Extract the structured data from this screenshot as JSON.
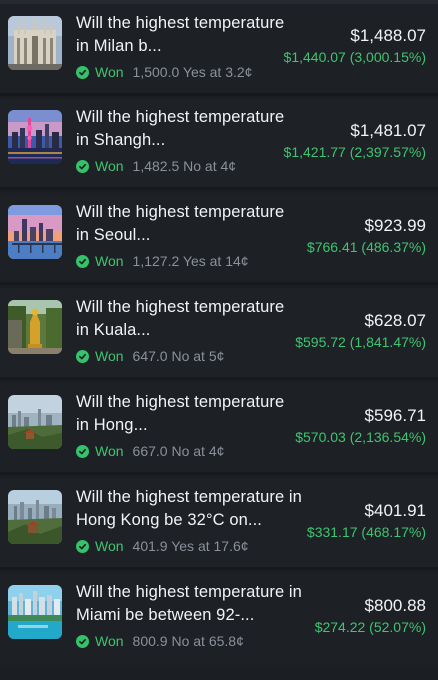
{
  "positions": [
    {
      "title": "Will the highest temperature in Milan b...",
      "status": "Won",
      "detail": "1,500.0 Yes at 3.2¢",
      "value": "$1,488.07",
      "pnl": "$1,440.07 (3,000.15%)",
      "image": "milan-cathedral-image"
    },
    {
      "title": "Will the highest temperature in Shangh...",
      "status": "Won",
      "detail": "1,482.5 No at 4¢",
      "value": "$1,481.07",
      "pnl": "$1,421.77 (2,397.57%)",
      "image": "shanghai-skyline-image"
    },
    {
      "title": "Will the highest temperature in Seoul...",
      "status": "Won",
      "detail": "1,127.2 Yes at 14¢",
      "value": "$923.99",
      "pnl": "$766.41 (486.37%)",
      "image": "seoul-skyline-image"
    },
    {
      "title": "Will the highest temperature in Kuala...",
      "status": "Won",
      "detail": "647.0 No at 5¢",
      "value": "$628.07",
      "pnl": "$595.72 (1,841.47%)",
      "image": "kuala-lumpur-statue-image"
    },
    {
      "title": "Will the highest temperature in Hong...",
      "status": "Won",
      "detail": "667.0 No at 4¢",
      "value": "$596.71",
      "pnl": "$570.03 (2,136.54%)",
      "image": "hong-kong-skyline-image"
    },
    {
      "title": "Will the highest temperature in Hong Kong be 32°C on...",
      "status": "Won",
      "detail": "401.9 Yes at 17.6¢",
      "value": "$401.91",
      "pnl": "$331.17 (468.17%)",
      "image": "hong-kong-harbour-image"
    },
    {
      "title": "Will the highest temperature in Miami be between 92-...",
      "status": "Won",
      "detail": "800.9 No at 65.8¢",
      "value": "$800.88",
      "pnl": "$274.22 (52.07%)",
      "image": "miami-skyline-image"
    }
  ],
  "colors": {
    "background": "#1b1e23",
    "text": "#f2f3f5",
    "won_green": "#3ec56f",
    "muted": "#8b9099"
  }
}
